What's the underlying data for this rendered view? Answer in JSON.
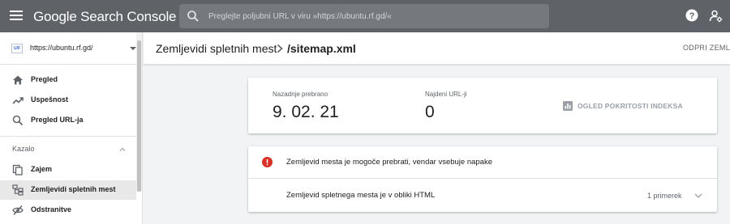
{
  "app": {
    "title": "Google Search Console"
  },
  "search": {
    "placeholder": "Preglejte poljubni URL v viru »https://ubuntu.rf.gd/«"
  },
  "sidebar": {
    "property": {
      "url": "https://ubuntu.rf.gd/",
      "logo_text": "U/F"
    },
    "items": [
      {
        "label": "Pregled",
        "icon": "home-icon"
      },
      {
        "label": "Uspešnost",
        "icon": "trending-up-icon"
      },
      {
        "label": "Pregled URL-ja",
        "icon": "search-icon"
      }
    ],
    "section": {
      "label": "Kazalo",
      "expanded": true
    },
    "section_items": [
      {
        "label": "Zajem",
        "icon": "copy-icon",
        "active": false
      },
      {
        "label": "Zemljevidi spletnih mest",
        "icon": "sitemap-icon",
        "active": true
      },
      {
        "label": "Odstranitve",
        "icon": "visibility-off-icon",
        "active": false
      }
    ]
  },
  "header": {
    "breadcrumb_parent": "Zemljevidi spletnih mest",
    "breadcrumb_current": "/sitemap.xml",
    "open_link": "ODPRI ZEMLJE"
  },
  "stats": {
    "last_read_label": "Nazadnje prebrano",
    "last_read_value": "9. 02. 21",
    "urls_found_label": "Najdeni URL-ji",
    "urls_found_value": "0",
    "coverage_button": "OGLED POKRITOSTI INDEKSA"
  },
  "issues": {
    "error_message": "Zemljevid mesta je mogoče prebrati, vendar vsebuje napake",
    "detail_message": "Zemljevid spletnega mesta je v obliki HTML",
    "detail_count": "1 primerek"
  },
  "colors": {
    "topbar": "#5f6368",
    "error": "#d93025",
    "active_nav": "#e8e8e8"
  }
}
